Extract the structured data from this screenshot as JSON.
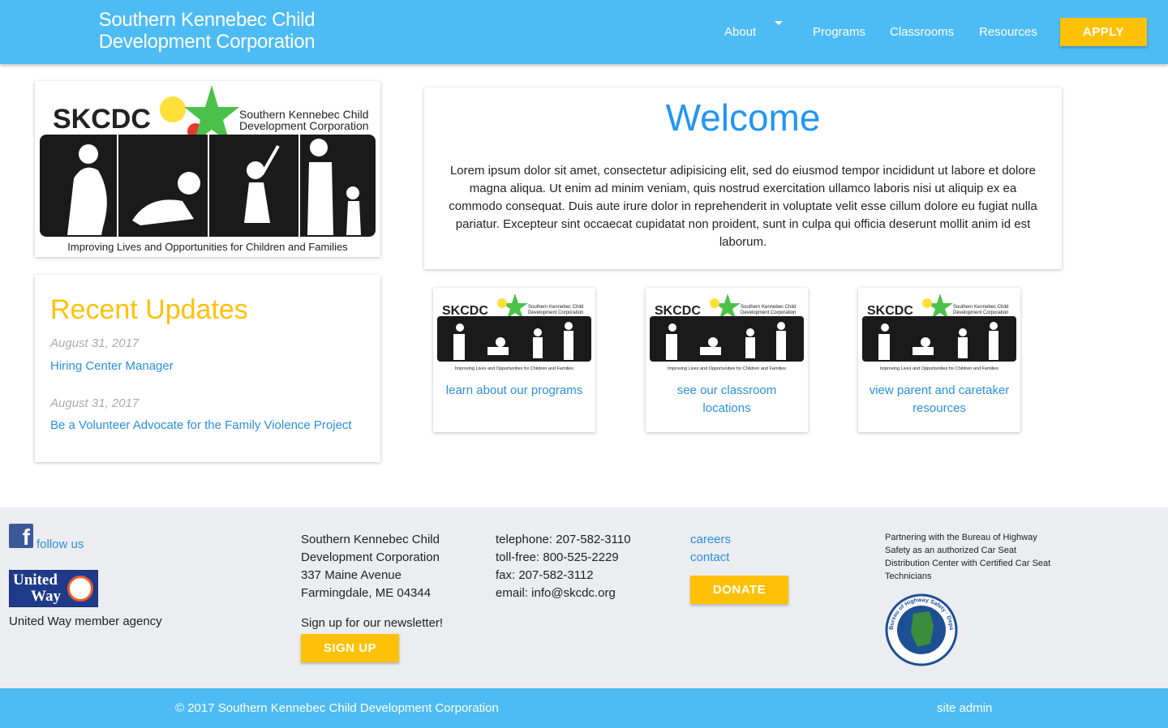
{
  "header": {
    "brand": "Southern Kennebec Child Development Corporation",
    "nav": [
      "About",
      "Programs",
      "Classrooms",
      "Resources"
    ],
    "apply": "APPLY"
  },
  "logo": {
    "abbr": "SKCDC",
    "name_line1": "Southern Kennebec Child",
    "name_line2": "Development Corporation",
    "tagline": "Improving Lives and Opportunities for Children and Families"
  },
  "updates": {
    "title": "Recent Updates",
    "items": [
      {
        "date": "August 31, 2017",
        "title": "Hiring Center Manager"
      },
      {
        "date": "August 31, 2017",
        "title": "Be a Volunteer Advocate for the Family Violence Project"
      }
    ]
  },
  "welcome": {
    "title": "Welcome",
    "body": "Lorem ipsum dolor sit amet, consectetur adipisicing elit, sed do eiusmod tempor incididunt ut labore et dolore magna aliqua. Ut enim ad minim veniam, quis nostrud exercitation ullamco laboris nisi ut aliquip ex ea commodo consequat. Duis aute irure dolor in reprehenderit in voluptate velit esse cillum dolore eu fugiat nulla pariatur. Excepteur sint occaecat cupidatat non proident, sunt in culpa qui officia deserunt mollit anim id est laborum."
  },
  "tiles": [
    {
      "label": "learn about our programs"
    },
    {
      "label": "see our classroom locations"
    },
    {
      "label": "view parent and caretaker resources"
    }
  ],
  "footer": {
    "follow": "follow us",
    "united_way_label": "United Way member agency",
    "uw_logo_text1": "United",
    "uw_logo_text2": "Way",
    "address": [
      "Southern Kennebec Child",
      "Development Corporation",
      "337 Maine Avenue",
      "Farmingdale, ME 04344"
    ],
    "newsletter": "Sign up for our newsletter!",
    "signup": "SIGN UP",
    "contact": [
      "telephone: 207-582-3110",
      "toll-free: 800-525-2229",
      "fax: 207-582-3112",
      "email: info@skcdc.org"
    ],
    "links": [
      "careers",
      "contact"
    ],
    "donate": "DONATE",
    "partner": "Partnering with the Bureau of Highway Safety as an authorized Car Seat Distribution Center with Certified Car Seat Technicians",
    "seal_text": "Bureau of Highway Safety · Department of Public Safety"
  },
  "bottom": {
    "copyright": "© 2017 Southern Kennebec Child Development Corporation",
    "admin": "site admin"
  }
}
